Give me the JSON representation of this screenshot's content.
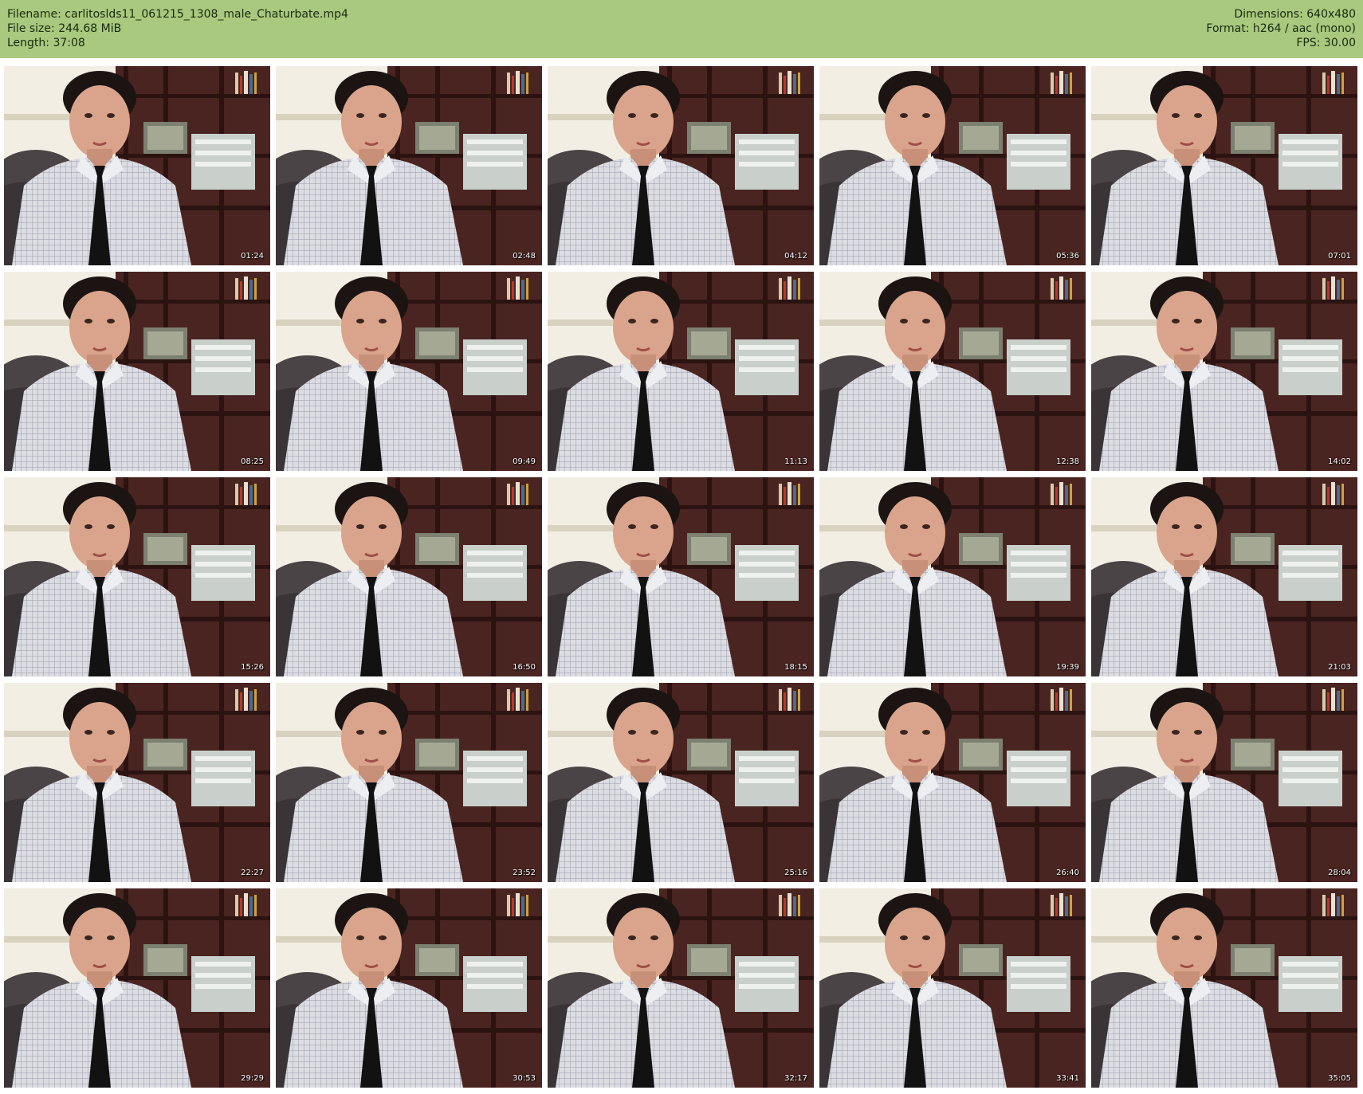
{
  "header": {
    "filename": "Filename: carlitoslds11_061215_1308_male_Chaturbate.mp4",
    "filesize": "File size: 244.68 MiB",
    "length": "Length: 37:08",
    "dimensions": "Dimensions: 640x480",
    "format": "Format: h264 / aac (mono)",
    "fps": "FPS: 30.00"
  },
  "colors": {
    "header_bg": "#a9c97e",
    "page_bg": "#ffffff"
  },
  "thumbnails": [
    {
      "timestamp": "01:24"
    },
    {
      "timestamp": "02:48"
    },
    {
      "timestamp": "04:12"
    },
    {
      "timestamp": "05:36"
    },
    {
      "timestamp": "07:01"
    },
    {
      "timestamp": "08:25"
    },
    {
      "timestamp": "09:49"
    },
    {
      "timestamp": "11:13"
    },
    {
      "timestamp": "12:38"
    },
    {
      "timestamp": "14:02"
    },
    {
      "timestamp": "15:26"
    },
    {
      "timestamp": "16:50"
    },
    {
      "timestamp": "18:15"
    },
    {
      "timestamp": "19:39"
    },
    {
      "timestamp": "21:03"
    },
    {
      "timestamp": "22:27"
    },
    {
      "timestamp": "23:52"
    },
    {
      "timestamp": "25:16"
    },
    {
      "timestamp": "26:40"
    },
    {
      "timestamp": "28:04"
    },
    {
      "timestamp": "29:29"
    },
    {
      "timestamp": "30:53"
    },
    {
      "timestamp": "32:17"
    },
    {
      "timestamp": "33:41"
    },
    {
      "timestamp": "35:05"
    }
  ]
}
